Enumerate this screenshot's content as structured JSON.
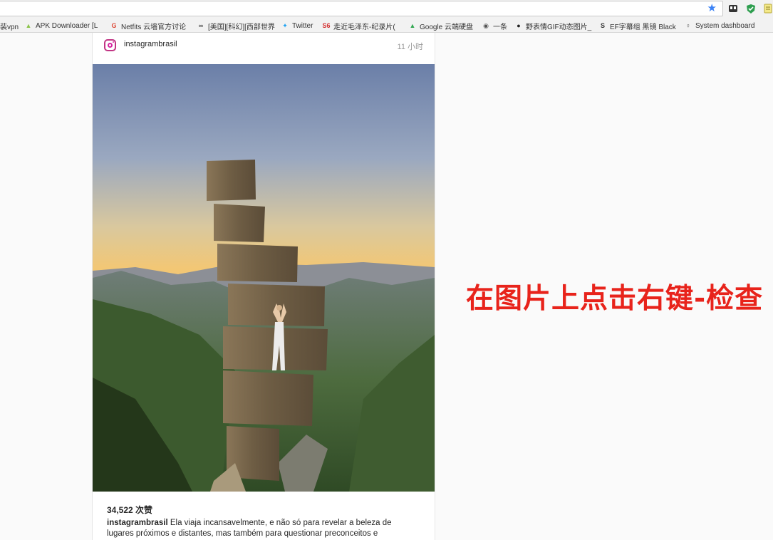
{
  "browser": {
    "bookmark_star": "star-icon",
    "extensions": [
      "extension-icon",
      "shield-icon",
      "extension-icon"
    ]
  },
  "bookmarks": [
    {
      "label": "装vpn",
      "icon": "bookmark-icon",
      "color": "#888888",
      "glyph": ""
    },
    {
      "label": "APK Downloader [L",
      "icon": "android-icon",
      "color": "#8bc34a",
      "glyph": "▲"
    },
    {
      "label": "Netfits 云墙官方讨论",
      "icon": "google-plus-icon",
      "color": "#dd4b39",
      "glyph": "G"
    },
    {
      "label": "[美国][科幻][西部世界",
      "icon": "link-icon",
      "color": "#555555",
      "glyph": "∞"
    },
    {
      "label": "Twitter",
      "icon": "twitter-icon",
      "color": "#1da1f2",
      "glyph": "✦"
    },
    {
      "label": "走近毛泽东-纪录片(",
      "icon": "s6-icon",
      "color": "#d32f2f",
      "glyph": "S6"
    },
    {
      "label": "Google 云端硬盘",
      "icon": "drive-icon",
      "color": "#34a853",
      "glyph": "▲"
    },
    {
      "label": "一条",
      "icon": "circle-icon",
      "color": "#555555",
      "glyph": "◉"
    },
    {
      "label": "野表情GIF动态图片_",
      "icon": "face-icon",
      "color": "#222222",
      "glyph": "●"
    },
    {
      "label": "EF字幕组 黑镜 Black",
      "icon": "s-icon",
      "color": "#333333",
      "glyph": "S"
    },
    {
      "label": "System dashboard",
      "icon": "person-icon",
      "color": "#333333",
      "glyph": "♀"
    }
  ],
  "post": {
    "username": "instagrambrasil",
    "time": "11 小时",
    "likes": "34,522 次赞",
    "caption_user": "instagrambrasil",
    "caption_text": "Ela viaja incansavelmente, e não só para revelar a beleza de lugares próximos e distantes, mas também para questionar preconceitos e"
  },
  "overlay": {
    "text": "在图片上点击右键-检查",
    "color": "#e8231b"
  }
}
